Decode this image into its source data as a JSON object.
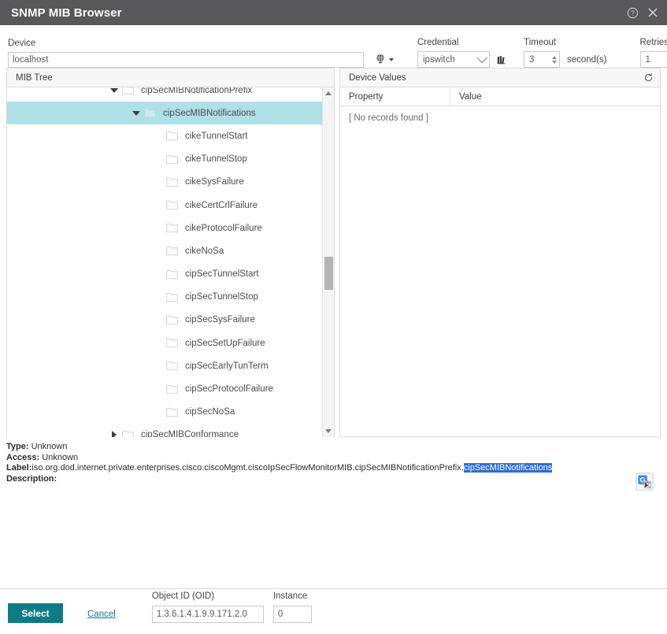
{
  "window": {
    "title": "SNMP MIB Browser",
    "help_icon": "help-circle-icon",
    "close_icon": "close-icon"
  },
  "toolbar": {
    "device": {
      "label": "Device",
      "value": "localhost",
      "placeholder": ""
    },
    "globe": {
      "icon": "globe-icon",
      "dropdown_icon": "caret-down-icon"
    },
    "credential": {
      "label": "Credential",
      "value": "ipswitch",
      "options": [
        "ipswitch"
      ],
      "books_icon": "books-icon"
    },
    "timeout": {
      "label": "Timeout",
      "value": "3",
      "unit": "second(s)"
    },
    "retries": {
      "label": "Retries",
      "value": "1"
    }
  },
  "mib_tree": {
    "header": "MIB Tree",
    "nodes": [
      {
        "label": "cipSecMIBNotificationPrefix",
        "indent": 0,
        "toggle": "open",
        "selected": false,
        "partial": true
      },
      {
        "label": "cipSecMIBNotifications",
        "indent": 1,
        "toggle": "open",
        "selected": true,
        "partial": false
      },
      {
        "label": "cikeTunnelStart",
        "indent": 2,
        "toggle": "none",
        "selected": false,
        "partial": false
      },
      {
        "label": "cikeTunnelStop",
        "indent": 2,
        "toggle": "none",
        "selected": false,
        "partial": false
      },
      {
        "label": "cikeSysFailure",
        "indent": 2,
        "toggle": "none",
        "selected": false,
        "partial": false
      },
      {
        "label": "cikeCertCrlFailure",
        "indent": 2,
        "toggle": "none",
        "selected": false,
        "partial": false
      },
      {
        "label": "cikeProtocolFailure",
        "indent": 2,
        "toggle": "none",
        "selected": false,
        "partial": false
      },
      {
        "label": "cikeNoSa",
        "indent": 2,
        "toggle": "none",
        "selected": false,
        "partial": false
      },
      {
        "label": "cipSecTunnelStart",
        "indent": 2,
        "toggle": "none",
        "selected": false,
        "partial": false
      },
      {
        "label": "cipSecTunnelStop",
        "indent": 2,
        "toggle": "none",
        "selected": false,
        "partial": false
      },
      {
        "label": "cipSecSysFailure",
        "indent": 2,
        "toggle": "none",
        "selected": false,
        "partial": false
      },
      {
        "label": "cipSecSetUpFailure",
        "indent": 2,
        "toggle": "none",
        "selected": false,
        "partial": false
      },
      {
        "label": "cipSecEarlyTunTerm",
        "indent": 2,
        "toggle": "none",
        "selected": false,
        "partial": false
      },
      {
        "label": "cipSecProtocolFailure",
        "indent": 2,
        "toggle": "none",
        "selected": false,
        "partial": false
      },
      {
        "label": "cipSecNoSa",
        "indent": 2,
        "toggle": "none",
        "selected": false,
        "partial": false
      },
      {
        "label": "cipSecMIBConformance",
        "indent": 0,
        "toggle": "closed",
        "selected": false,
        "partial": false
      }
    ]
  },
  "device_values": {
    "header": "Device Values",
    "refresh_icon": "refresh-icon",
    "columns": [
      "Property",
      "Value"
    ],
    "empty_text": "[ No records found ]",
    "rows": []
  },
  "details": {
    "type_key": "Type:",
    "type_value": "Unknown",
    "access_key": "Access:",
    "access_value": "Unknown",
    "label_key": "Label:",
    "label_prefix": "iso.org.dod.internet.private.enterprises.cisco.ciscoMgmt.ciscoIpSecFlowMonitorMIB.cipSecMIBNotificationPrefix.",
    "label_highlight": "cipSecMIBNotifications",
    "description_key": "Description:",
    "description_value": "",
    "translate_icon": "translate-icon"
  },
  "footer": {
    "select_label": "Select",
    "cancel_label": "Cancel",
    "oid": {
      "label": "Object ID (OID)",
      "value": "1.3.6.1.4.1.9.9.171.2.0"
    },
    "instance": {
      "label": "Instance",
      "value": "0"
    }
  },
  "colors": {
    "titlebar": "#58585a",
    "accent": "#0e7c86",
    "tree_selection": "#aee0e8",
    "text_highlight": "#2a6fd6"
  }
}
